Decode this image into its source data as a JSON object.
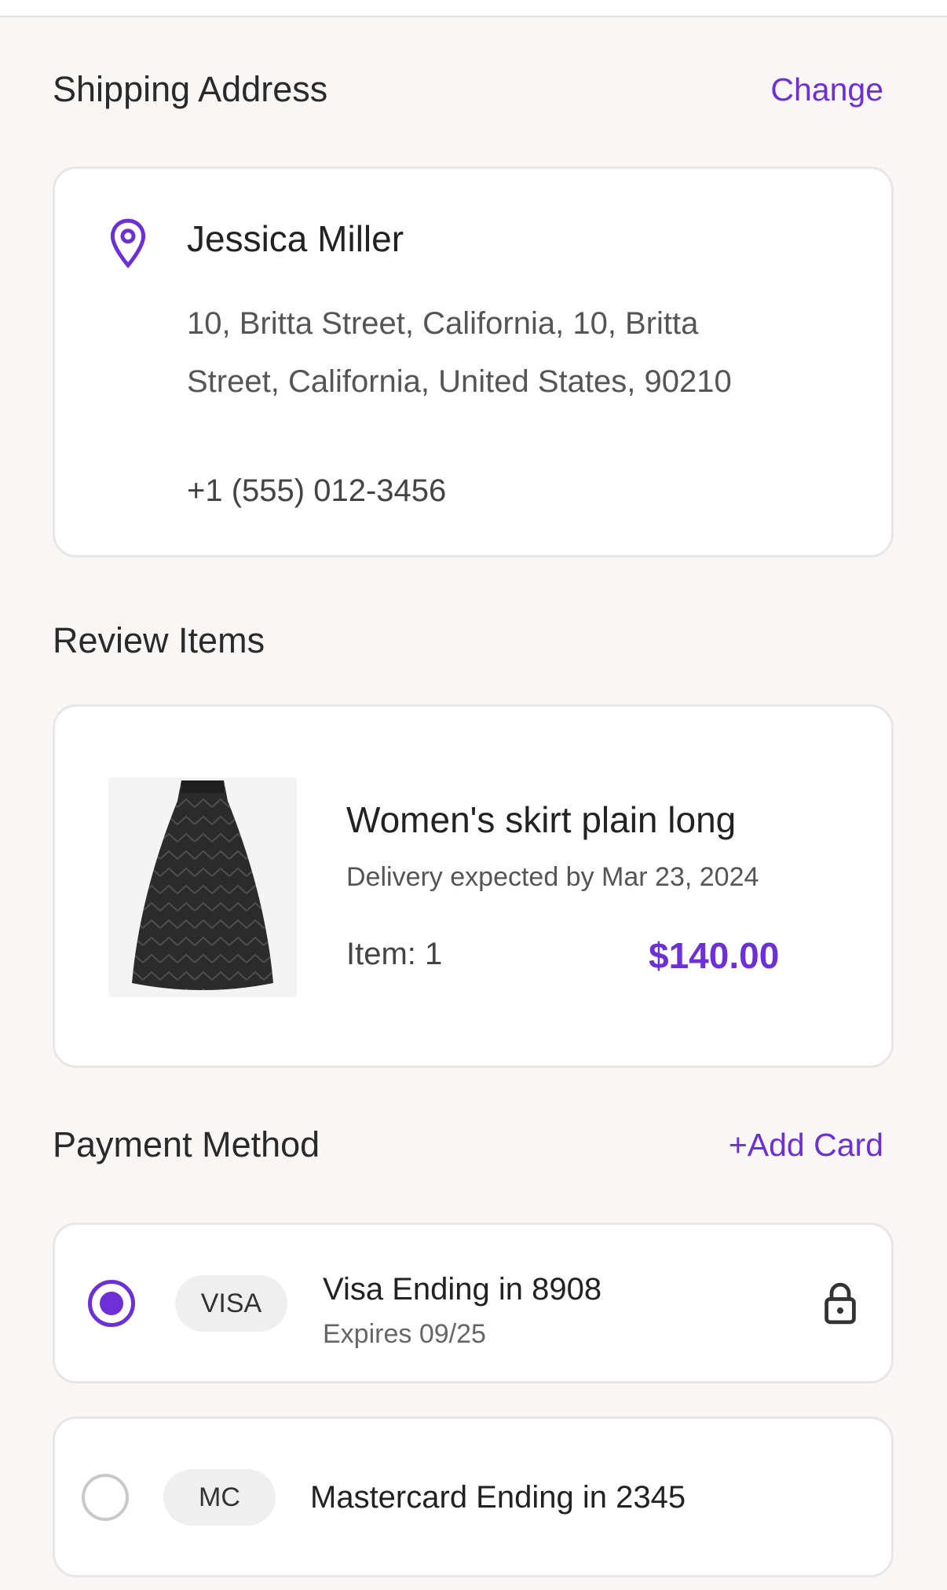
{
  "shipping": {
    "title": "Shipping Address",
    "change_label": "Change",
    "name": "Jessica Miller",
    "address": "10, Britta Street, California, 10, Britta Street, California, United States, 90210",
    "phone": "+1 (555) 012-3456",
    "icon": "location-pin-icon"
  },
  "review": {
    "title": "Review Items",
    "items": [
      {
        "name": "Women's skirt plain long",
        "delivery": "Delivery expected by Mar 23, 2024",
        "qty_label": "Item: 1",
        "price": "$140.00"
      }
    ]
  },
  "payment": {
    "title": "Payment Method",
    "add_label": "+Add Card",
    "methods": [
      {
        "badge": "VISA",
        "title": "Visa Ending in 8908",
        "sub": "Expires 09/25",
        "selected": true,
        "icon": "lock-icon"
      },
      {
        "badge": "MC",
        "title": "Mastercard Ending in 2345",
        "selected": false
      }
    ]
  },
  "colors": {
    "accent": "#6c2fd8",
    "background": "#f9f6f6",
    "card": "#ffffff"
  }
}
